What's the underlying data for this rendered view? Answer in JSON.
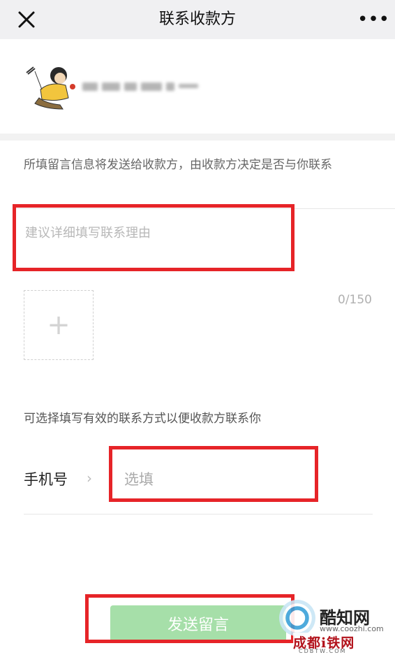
{
  "nav": {
    "title": "联系收款方",
    "close_icon": "close-icon",
    "more_icon": "more-icon",
    "more_glyph": "•••"
  },
  "profile": {
    "avatar_icon": "cartoon-avatar-image"
  },
  "form": {
    "hint": "所填留言信息将发送给收款方，由收款方决定是否与你联系",
    "message_placeholder": "建议详细填写联系理由",
    "counter": "0/150",
    "add_photo_glyph": "+",
    "contact_hint": "可选择填写有效的联系方式以便收款方联系你",
    "phone_label": "手机号",
    "phone_chevron": "›",
    "phone_placeholder": "选填"
  },
  "actions": {
    "send_label": "发送留言"
  },
  "watermark": {
    "name": "酷知网",
    "url": "www.coozhi.com",
    "site": "成都i",
    "site2": "铁网",
    "site_sub": "CDBTW.COM"
  },
  "colors": {
    "highlight": "#e62428",
    "send_button": "#a6dfa9",
    "navbar": "#f0f0f2"
  }
}
